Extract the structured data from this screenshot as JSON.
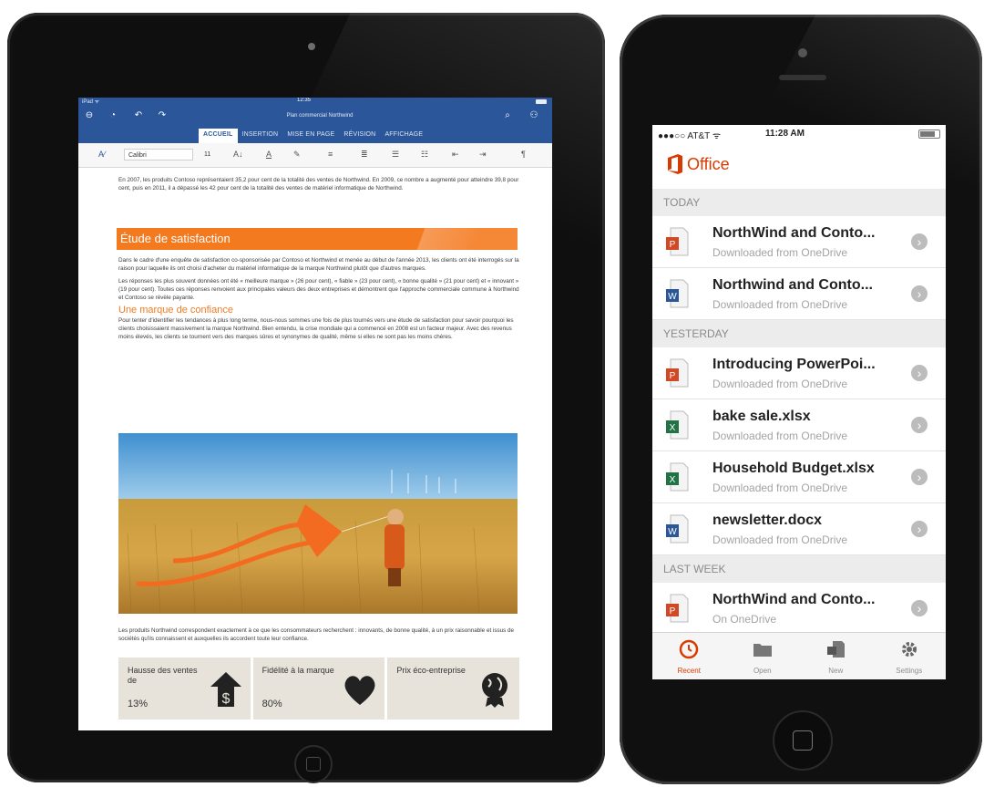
{
  "ipad": {
    "status_left": "iPad ᯤ",
    "clock": "12:35",
    "doc_title": "Plan commercial Northwind",
    "tabs": [
      "ACCUEIL",
      "INSERTION",
      "MISE EN PAGE",
      "RÉVISION",
      "AFFICHAGE"
    ],
    "active_tab": "ACCUEIL",
    "font_name": "Calibri",
    "font_size": "11",
    "para1": "En 2007, les produits Contoso représentaient 35,2 pour cent de la totalité des ventes de Northwind. En 2009, ce nombre a augmenté pour atteindre 39,8 pour cent, puis en 2011, il a dépassé les 42 pour cent de la totalité des ventes de matériel informatique de Northwind.",
    "banner_heading": "Étude de satisfaction",
    "para2": "Dans le cadre d'une enquête de satisfaction co-sponsorisée par Contoso et Northwind et menée au début de l'année 2013, les clients ont été interrogés sur la raison pour laquelle ils ont choisi d'acheter du matériel informatique de la marque Northwind plutôt que d'autres marques.",
    "para3": "Les réponses les plus souvent données ont été « meilleure marque » (26 pour cent), « fiable » (23 pour cent), « bonne qualité » (21 pour cent) et « innovant » (19 pour cent). Toutes ces réponses renvoient aux principales valeurs des deux entreprises et démontrent que l'approche commerciale commune à Northwind et Contoso se révèle payante.",
    "subheading": "Une marque de confiance",
    "para4": "Pour tenter d'identifier les tendances à plus long terme, nous-nous sommes une fois de plus tournés vers une étude de satisfaction pour savoir pourquoi les clients choisissaient massivement la marque Northwind. Bien entendu, la crise mondiale qui a commencé en 2008 est un facteur majeur. Avec des revenus moins élevés, les clients se tournent vers des marques sûres et synonymes de qualité, même si elles ne sont pas les moins chères.",
    "caption": "Les produits Northwind correspondent exactement à ce que les consommateurs recherchent : innovants, de bonne qualité, à un prix raisonnable et issus de sociétés qu'ils connaissent et auxquelles ils accordent toute leur confiance.",
    "stats": [
      {
        "label": "Hausse des ventes de",
        "value": "13%",
        "icon": "dollar-arrow-icon"
      },
      {
        "label": "Fidélité à la marque",
        "value": "80%",
        "icon": "heart-icon"
      },
      {
        "label": "Prix éco-entreprise",
        "value": "",
        "icon": "globe-award-icon"
      }
    ]
  },
  "iphone": {
    "carrier": "●●●○○ AT&T ᯤ",
    "time": "11:28 AM",
    "app_name": "Office",
    "sections": [
      {
        "title": "TODAY",
        "items": [
          {
            "name": "NorthWind and Conto...",
            "sub": "Downloaded from OneDrive",
            "type": "ppt"
          },
          {
            "name": "Northwind and Conto...",
            "sub": "Downloaded from OneDrive",
            "type": "word"
          }
        ]
      },
      {
        "title": "YESTERDAY",
        "items": [
          {
            "name": "Introducing PowerPoi...",
            "sub": "Downloaded from OneDrive",
            "type": "ppt"
          },
          {
            "name": "bake sale.xlsx",
            "sub": "Downloaded from OneDrive",
            "type": "excel"
          },
          {
            "name": "Household Budget.xlsx",
            "sub": "Downloaded from OneDrive",
            "type": "excel"
          },
          {
            "name": "newsletter.docx",
            "sub": "Downloaded from OneDrive",
            "type": "word"
          }
        ]
      },
      {
        "title": "LAST WEEK",
        "items": [
          {
            "name": "NorthWind and Conto...",
            "sub": "On OneDrive",
            "type": "ppt"
          }
        ]
      }
    ],
    "tabs": [
      {
        "label": "Recent",
        "icon": "clock-icon",
        "active": true
      },
      {
        "label": "Open",
        "icon": "folder-icon",
        "active": false
      },
      {
        "label": "New",
        "icon": "new-doc-icon",
        "active": false
      },
      {
        "label": "Settings",
        "icon": "gear-icon",
        "active": false
      }
    ]
  },
  "colors": {
    "word_blue": "#2b579a",
    "office_orange": "#d83b01",
    "banner_orange": "#f47a20",
    "excel_green": "#217346",
    "ppt_red": "#d24726"
  }
}
